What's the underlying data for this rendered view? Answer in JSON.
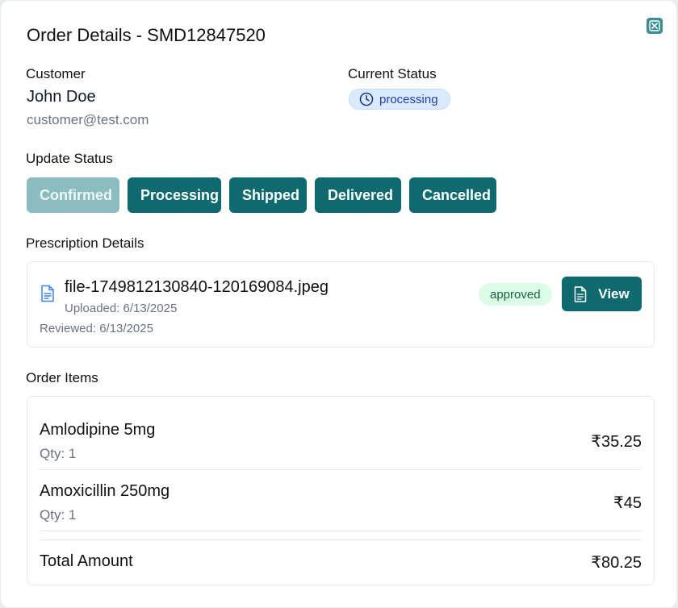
{
  "modal": {
    "title": "Order Details - SMD12847520",
    "close_icon": "close-icon"
  },
  "customer": {
    "label": "Customer",
    "name": "John Doe",
    "email": "customer@test.com"
  },
  "current_status": {
    "label": "Current Status",
    "value": "processing",
    "icon": "clock-icon"
  },
  "update_status": {
    "label": "Update Status",
    "buttons": [
      {
        "label": "Confirmed",
        "disabled": true
      },
      {
        "label": "Processing",
        "disabled": false
      },
      {
        "label": "Shipped",
        "disabled": false
      },
      {
        "label": "Delivered",
        "disabled": false
      },
      {
        "label": "Cancelled",
        "disabled": false
      }
    ]
  },
  "prescription": {
    "label": "Prescription Details",
    "file_name": "file-1749812130840-120169084.jpeg",
    "uploaded": "Uploaded: 6/13/2025",
    "reviewed": "Reviewed: 6/13/2025",
    "status": "approved",
    "view_label": "View"
  },
  "order_items": {
    "label": "Order Items",
    "items": [
      {
        "name": "Amlodipine 5mg",
        "qty": "Qty: 1",
        "price": "₹35.25"
      },
      {
        "name": "Amoxicillin 250mg",
        "qty": "Qty: 1",
        "price": "₹45"
      }
    ],
    "total_label": "Total Amount",
    "total_value": "₹80.25"
  },
  "colors": {
    "primary": "#0e6a6f",
    "primary_disabled": "#8bbcbf",
    "status_badge_bg": "#dbeafe",
    "approved_bg": "#dcfce7"
  }
}
